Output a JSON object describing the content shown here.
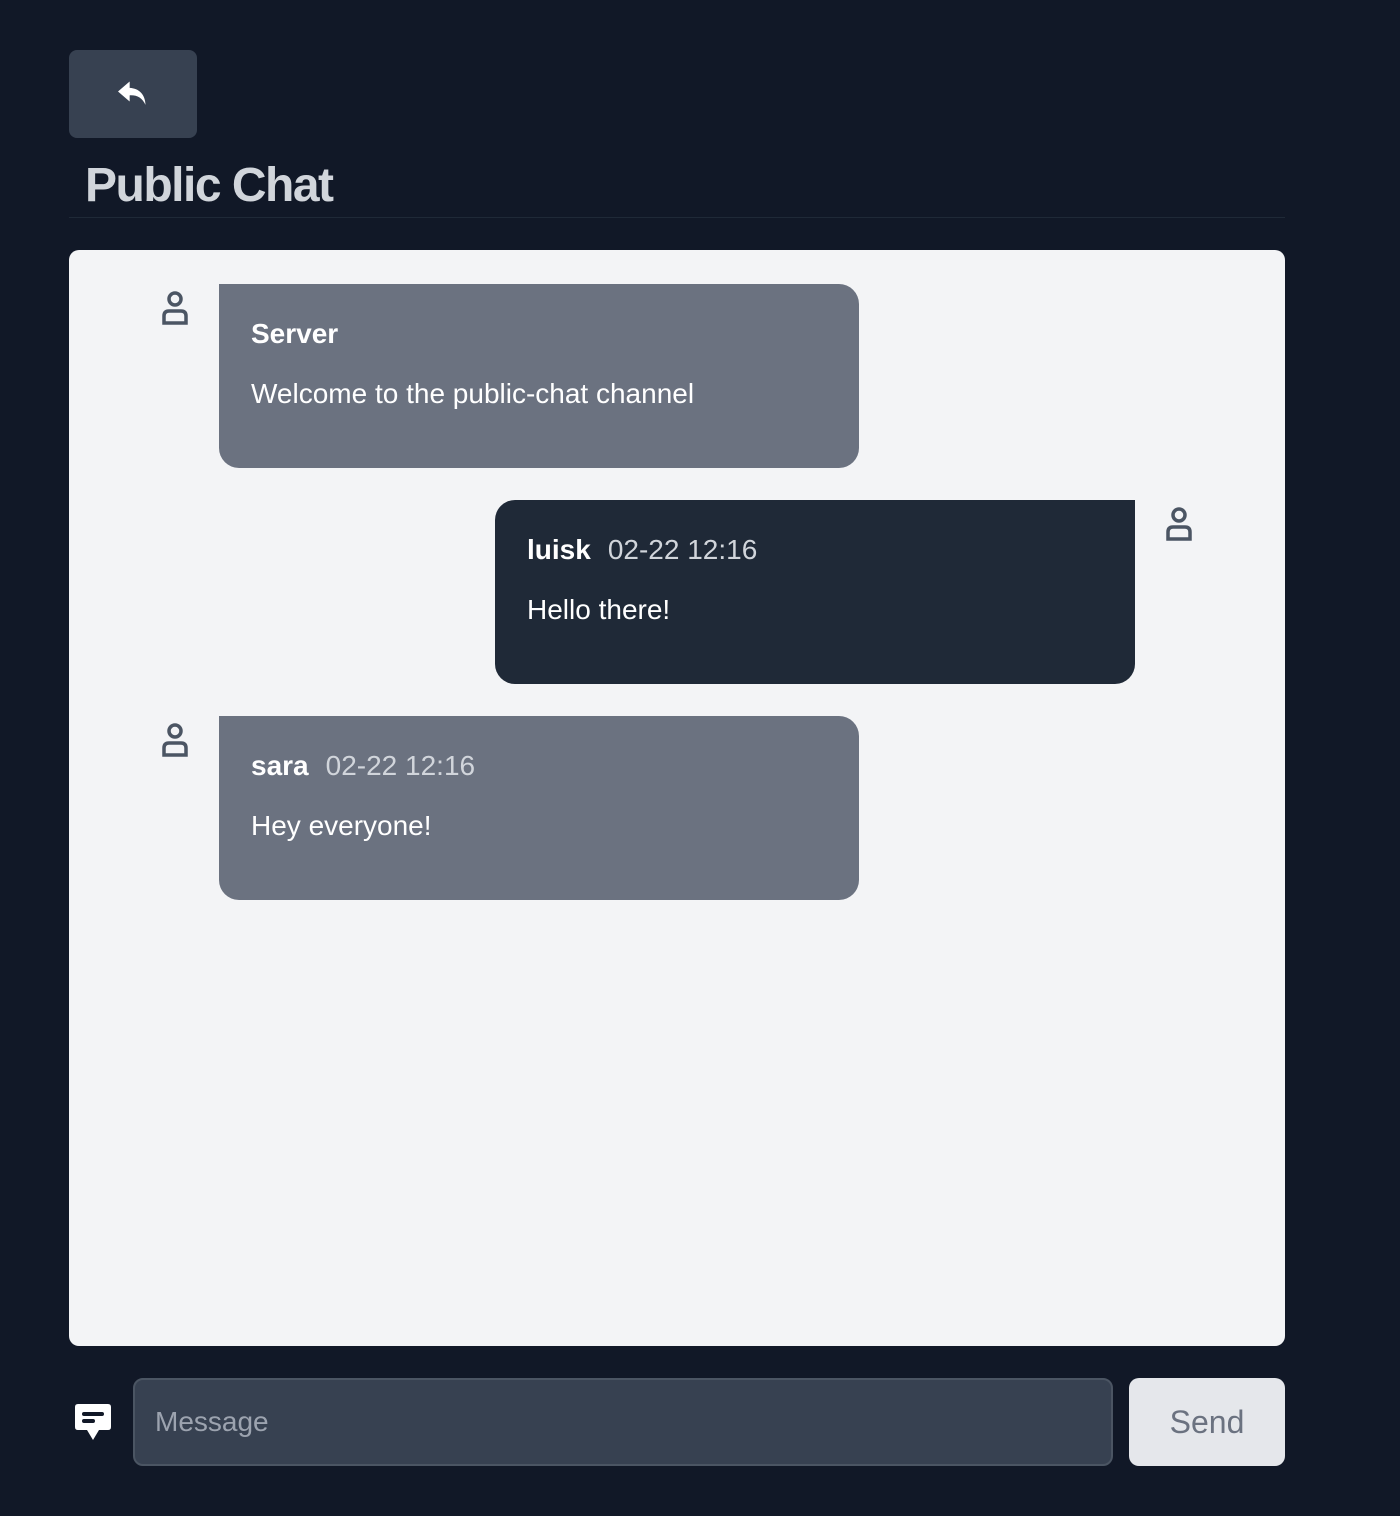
{
  "header": {
    "back_icon": "reply-arrow-icon",
    "title": "Public Chat"
  },
  "messages": [
    {
      "author": "Server",
      "time": "",
      "text": "Welcome to the public-chat channel",
      "side": "left",
      "avatar_icon": "user-icon"
    },
    {
      "author": "luisk",
      "time": "02-22 12:16",
      "text": "Hello there!",
      "side": "right",
      "avatar_icon": "user-icon"
    },
    {
      "author": "sara",
      "time": "02-22 12:16",
      "text": "Hey everyone!",
      "side": "left",
      "avatar_icon": "user-icon"
    }
  ],
  "composer": {
    "icon": "chat-bubble-icon",
    "placeholder": "Message",
    "value": "",
    "send_label": "Send"
  },
  "colors": {
    "background": "#111827",
    "panel": "#f3f4f6",
    "other_bubble": "#6b7280",
    "own_bubble": "#1f2937",
    "accent_button": "#374151"
  }
}
